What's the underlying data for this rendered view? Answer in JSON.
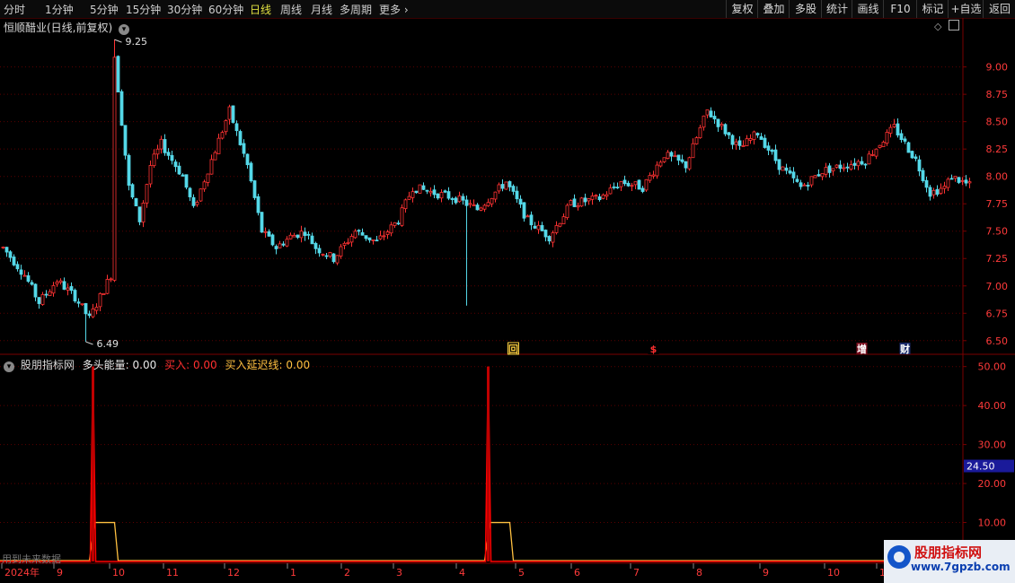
{
  "toolbar": {
    "periods": [
      "分时",
      "1分钟",
      "5分钟",
      "15分钟",
      "30分钟",
      "60分钟",
      "日线",
      "周线",
      "月线",
      "多周期",
      "更多"
    ],
    "active_period": "日线",
    "right_buttons": [
      "复权",
      "叠加",
      "多股",
      "统计",
      "画线",
      "F10",
      "标记",
      "+自选",
      "返回"
    ]
  },
  "main_panel": {
    "title": "恒顺醋业(日线,前复权)",
    "high_label": "9.25",
    "low_label": "6.49",
    "markers": [
      "回",
      "$",
      "增",
      "财"
    ]
  },
  "indicator_panel": {
    "name": "股朋指标网",
    "field1_label": "多头能量:",
    "field1_value": "0.00",
    "field2_label": "买入:",
    "field2_value": "0.00",
    "field3_label": "买入延迟线:",
    "field3_value": "0.00",
    "current_value": "24.50"
  },
  "footer": {
    "note": "用到未来数据",
    "x_labels": [
      "2024年",
      "9",
      "10",
      "11",
      "12",
      "1",
      "2",
      "3",
      "4",
      "5",
      "6",
      "7",
      "8",
      "9",
      "10",
      "1"
    ]
  },
  "watermark": {
    "title": "股朋指标网",
    "url": "www.7gpzb.com"
  },
  "colors": {
    "up": "#ff3232",
    "down": "#54d8e8",
    "buy": "#ff0000",
    "delay": "#ffc040",
    "axis": "#7a0000"
  },
  "chart_data": [
    {
      "type": "candlestick",
      "title": "恒顺醋业(日线,前复权)",
      "y_ticks": [
        6.5,
        6.75,
        7.0,
        7.25,
        7.5,
        7.75,
        8.0,
        8.25,
        8.5,
        8.75,
        9.0
      ],
      "ylim": [
        6.4,
        9.3
      ],
      "high": 9.25,
      "low": 6.49,
      "trend_x": [
        0,
        6,
        10,
        15,
        20,
        24,
        30,
        31,
        35,
        38,
        41,
        44,
        50,
        53,
        58,
        63,
        68,
        72,
        76,
        80,
        84,
        87,
        92,
        98,
        104,
        110,
        114,
        120,
        126,
        132,
        140,
        146,
        152,
        158,
        166,
        172,
        178,
        184,
        190,
        196,
        200,
        205,
        210,
        216,
        222,
        228,
        234,
        240,
        244,
        248,
        254,
        258,
        262,
        264,
        270
      ],
      "trend_y": [
        7.35,
        7.1,
        6.85,
        7.05,
        6.9,
        6.7,
        7.1,
        9.1,
        7.9,
        7.6,
        8.1,
        8.3,
        8.0,
        7.7,
        8.15,
        8.6,
        8.1,
        7.5,
        7.35,
        7.45,
        7.5,
        7.35,
        7.25,
        7.5,
        7.4,
        7.6,
        7.9,
        7.85,
        7.8,
        7.7,
        7.95,
        7.6,
        7.45,
        7.75,
        7.8,
        7.95,
        7.9,
        8.2,
        8.1,
        8.6,
        8.45,
        8.25,
        8.4,
        8.1,
        7.9,
        8.05,
        8.1,
        8.15,
        8.3,
        8.45,
        8.15,
        7.85,
        7.9,
        8.0,
        7.9
      ],
      "x_ticks": [
        "2024年",
        "9",
        "10",
        "11",
        "12",
        "1",
        "2",
        "3",
        "4",
        "5",
        "6",
        "7",
        "8",
        "9",
        "10",
        "1"
      ],
      "markers": [
        {
          "label": "回",
          "x": 142
        },
        {
          "label": "$",
          "x": 181
        },
        {
          "label": "增",
          "x": 239
        },
        {
          "label": "财",
          "x": 251
        }
      ]
    },
    {
      "type": "line",
      "title": "股朋指标网",
      "y_ticks": [
        10,
        20,
        30,
        40,
        50
      ],
      "ylim": [
        0,
        52
      ],
      "current_value": 24.5,
      "series": [
        {
          "name": "买入",
          "color": "#ff0000",
          "spikes": [
            {
              "x": 25,
              "value": 50
            },
            {
              "x": 135,
              "value": 50
            }
          ]
        },
        {
          "name": "买入延迟线",
          "color": "#ffc040",
          "plateaus": [
            {
              "x_start": 24,
              "x_end": 32,
              "value": 10
            },
            {
              "x_start": 134,
              "x_end": 142,
              "value": 10
            }
          ]
        }
      ]
    }
  ]
}
